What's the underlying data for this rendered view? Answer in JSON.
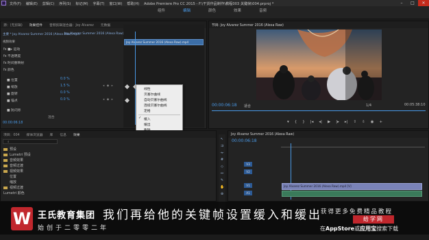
{
  "titlebar": {
    "menus": [
      "文件(F)",
      "编辑(E)",
      "剪辑(C)",
      "序列(S)",
      "标记(M)",
      "字幕(T)",
      "窗口(W)",
      "帮助(H)"
    ],
    "title": "Adobe Premiere Pro CC 2015 - F:\\干货作品制作\\教程003 关键帧\\004.prproj *"
  },
  "workspace": {
    "tabs": [
      "组件",
      "编辑",
      "颜色",
      "效果",
      "音频"
    ],
    "active": "编辑"
  },
  "effect_controls": {
    "tabs": [
      "源：(无剪辑)",
      "效果控件",
      "音频剪辑混合器：Joy Alvarez",
      "元数据"
    ],
    "active_tab": "效果控件",
    "clip_header": "主要 * Joy Alvarez Summer 2016 (Alexa Raw).mp4",
    "sequence_header": "Joy Alvarez Summer 2016 (Alexa Raw) ...",
    "mini_clip_label": "Joy Alvarez Summer 2016 (Alexa Raw).mp4",
    "section_label": "视频效果",
    "rows": [
      {
        "label": "fx ■▸ 运动",
        "value": ""
      },
      {
        "label": "fx 不透明度",
        "value": ""
      },
      {
        "label": "fx 时间重映射",
        "value": ""
      },
      {
        "label": "fx 颜色",
        "value": ""
      },
      {
        "label": "■ 位置",
        "value": "0.0 %"
      },
      {
        "label": "■ 缩放",
        "value": "1.5 %"
      },
      {
        "label": "■ 旋转",
        "value": "0.0 %"
      },
      {
        "label": "■ 锚点",
        "value": "0.0 %"
      },
      {
        "label": "■ 防闪烁",
        "value": "0.0 %"
      }
    ],
    "footer_timecode": "00:00:06:18",
    "blend_mode_label": "混合",
    "blend_mode_value": "正常"
  },
  "context_menu": {
    "items": [
      {
        "label": "线性",
        "checked": false,
        "submenu": false
      },
      {
        "label": "贝塞尔曲线",
        "checked": false,
        "submenu": false
      },
      {
        "label": "自动贝塞尔曲线",
        "checked": false,
        "submenu": false
      },
      {
        "label": "连续贝塞尔曲线",
        "checked": false,
        "submenu": false
      },
      {
        "label": "定格",
        "checked": false,
        "submenu": false
      },
      {
        "label": "缓入",
        "checked": true,
        "submenu": false
      },
      {
        "label": "缓出",
        "checked": false,
        "submenu": false
      },
      {
        "label": "删除",
        "checked": false,
        "submenu": false
      },
      {
        "label": "临时插值",
        "checked": false,
        "submenu": true
      },
      {
        "label": "空间插值",
        "checked": false,
        "submenu": true
      },
      {
        "label": "剪切",
        "checked": false,
        "submenu": false
      },
      {
        "label": "复制",
        "checked": false,
        "submenu": false
      },
      {
        "label": "粘贴",
        "checked": false,
        "submenu": false
      },
      {
        "label": "清除",
        "checked": false,
        "submenu": false
      }
    ]
  },
  "program_monitor": {
    "tab": "节目: Joy Alvarez Summer 2016 (Alexa Raw)",
    "current_time": "00:00:06:18",
    "fit": "适合",
    "quality": "1/4",
    "duration": "00:05:38:10"
  },
  "project": {
    "tabs": [
      "项目：004",
      "媒体浏览器",
      "库",
      "信息",
      "效果"
    ],
    "active_tab": "效果",
    "search_placeholder": "",
    "folders": [
      "预设",
      "Lumetri 预设",
      "音频效果",
      "音频过渡",
      "视频效果",
      "视频过渡"
    ],
    "expanded_items": [
      "位置",
      "缩放"
    ],
    "bottom_items": [
      "视频过渡",
      "Lumetri 颜色"
    ]
  },
  "timeline": {
    "tab": "Joy Alvarez Summer 2016 (Alexa Raw)",
    "current_time": "00:00:06:18",
    "tracks": [
      "V3",
      "V2",
      "V1",
      "A1",
      "A2",
      "A3"
    ],
    "clip_label": "Joy Alvarez Summer 2016 (Alexa Raw).mp4 [V]"
  },
  "overlay": {
    "logo_letter": "W",
    "brand_name": "王氏教育集团",
    "brand_since": "始创于二零零二年",
    "subtitle": "我们再给他的关键帧设置缓入和缓出",
    "promo_line1": "获得更多免费精品教程",
    "promo_brand": "给学网",
    "promo_line2_prefix": "在",
    "promo_appstore": "AppStore",
    "promo_line2_mid": "或",
    "promo_app": "应用宝",
    "promo_line2_suffix": "搜索下载"
  },
  "colors": {
    "accent": "#4a9ae8",
    "brand_red": "#c1272d",
    "panel_bg": "#232323",
    "clip_blue": "#3c6ea7",
    "clip_purple": "#7a83b8"
  }
}
